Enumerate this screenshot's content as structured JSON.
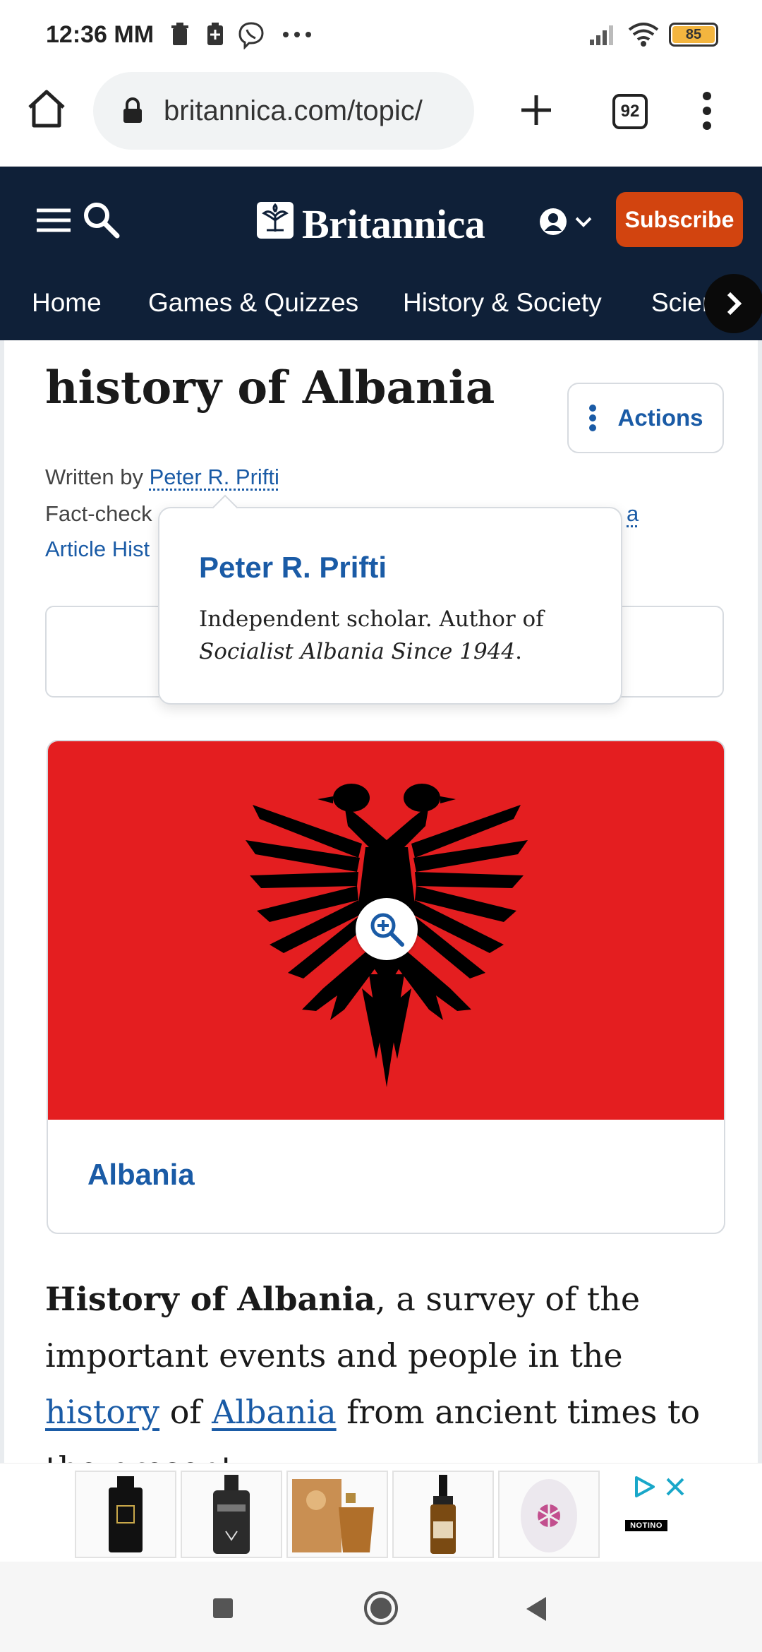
{
  "status_bar": {
    "time": "12:36 MM",
    "battery": "85"
  },
  "browser": {
    "url": "britannica.com/topic/",
    "tab_count": "92"
  },
  "site": {
    "brand": "Britannica",
    "subscribe_label": "Subscribe",
    "nav": [
      "Home",
      "Games & Quizzes",
      "History & Society",
      "Science"
    ]
  },
  "article": {
    "title": "history of Albania",
    "actions_label": "Actions",
    "written_by_label": "Written by",
    "author": "Peter R. Prifti",
    "fact_checked_partial": "Fact-check",
    "fact_checked_tail": "a",
    "article_history_partial": "Article Hist",
    "popover": {
      "name": "Peter R. Prifti",
      "bio_prefix": "Independent scholar. Author of",
      "bio_book": "Socialist Albania Since 1944",
      "bio_suffix": "."
    },
    "media_caption": "Albania",
    "intro": {
      "lead_bold": "History of Albania",
      "text1": ", a survey of the important events and people in the ",
      "link1": "history",
      "text2": " of ",
      "link2": "Albania",
      "text3": " from ancient times to the present."
    }
  },
  "ad": {
    "brand": "NOTINO",
    "products": [
      "perfume-black-bottle",
      "barberism-cologne",
      "gift-box-set",
      "serum-dropper",
      "pink-perfume"
    ]
  },
  "colors": {
    "header_bg": "#0f2038",
    "subscribe_bg": "#d2440f",
    "link": "#1a5ba6",
    "flag_red": "#e41e20"
  }
}
